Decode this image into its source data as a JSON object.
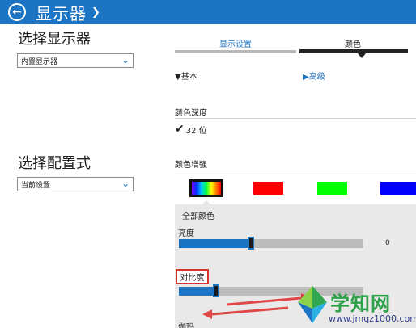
{
  "header": {
    "title": "显示器"
  },
  "left": {
    "select_display_title": "选择显示器",
    "display_select_value": "内置显示器",
    "select_profile_title": "选择配置式",
    "profile_select_value": "当前设置"
  },
  "tabs": [
    {
      "label": "显示设置"
    },
    {
      "label": "颜色"
    }
  ],
  "modes": {
    "basic": "基本",
    "advanced": "高级"
  },
  "color_depth": {
    "label": "颜色深度",
    "value": "32 位"
  },
  "color_enhance": {
    "label": "颜色增强",
    "swatches": [
      "all-colors",
      "red",
      "green",
      "blue"
    ],
    "colors": {
      "red": "#ff0000",
      "green": "#00ff00",
      "blue": "#0000ff",
      "accent": "#1c74c4"
    }
  },
  "panel": {
    "title": "全部颜色",
    "brightness": {
      "label": "亮度",
      "value_text": "0",
      "level": 0.39
    },
    "contrast": {
      "label": "对比度",
      "level": 0.2
    },
    "gamma": {
      "label": "伽玛"
    }
  },
  "watermark": {
    "title": "学知网",
    "url": "www.jmqz1000.com"
  }
}
